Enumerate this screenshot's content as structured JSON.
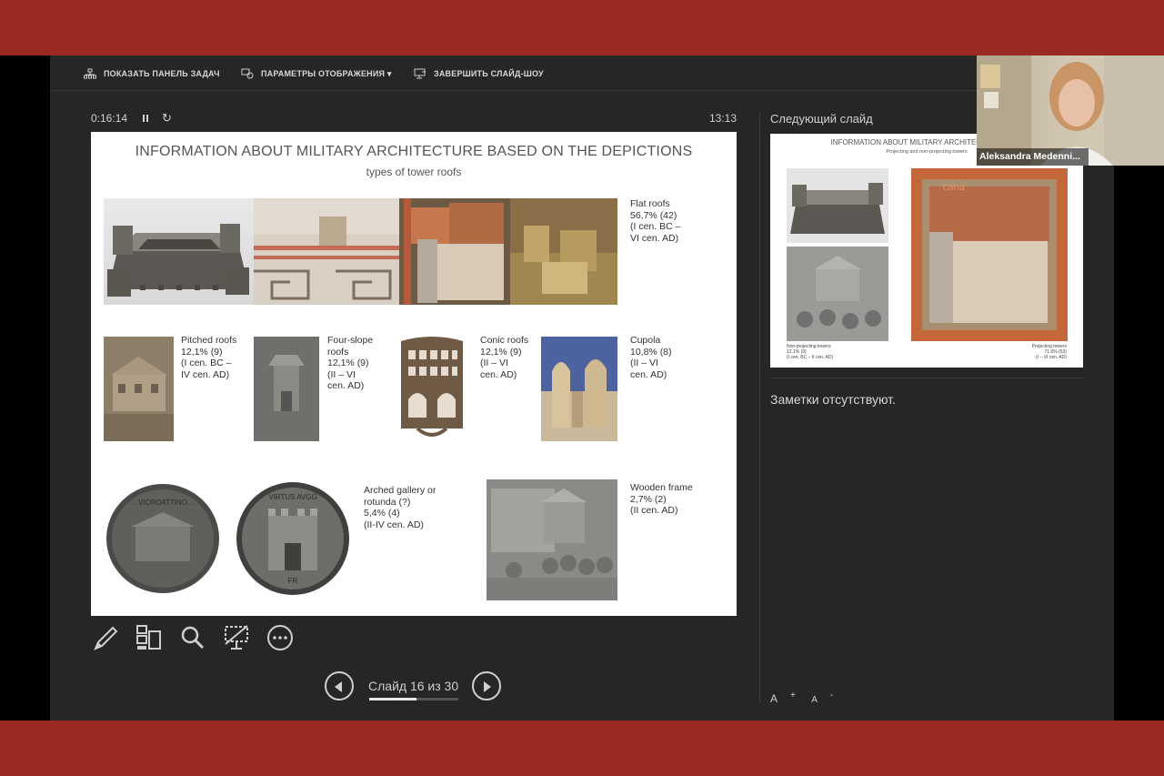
{
  "frame": {
    "band_color": "#9a2a22",
    "panel_color": "#262626"
  },
  "toolbar": {
    "show_taskbar": "ПОКАЗАТЬ ПАНЕЛЬ ЗАДАЧ",
    "display_settings": "ПАРАМЕТРЫ ОТОБРАЖЕНИЯ ▾",
    "end_show": "ЗАВЕРШИТЬ СЛАЙД-ШОУ"
  },
  "timer": {
    "elapsed": "0:16:14",
    "reset_glyph": "↻",
    "clock": "13:13"
  },
  "slide": {
    "title": "INFORMATION ABOUT MILITARY ARCHITECTURE BASED ON THE DEPICTIONS",
    "subtitle": "types of tower roofs",
    "labels": {
      "flat": "Flat roofs\n56,7% (42)\n(I  cen. BC –\nVI cen. AD)",
      "pitched": "Pitched roofs\n12,1% (9)\n(I cen. BC –\nIV cen. AD)",
      "four_slope": "Four-slope\nroofs\n12,1% (9)\n(II – VI\ncen. AD)",
      "conic": "Conic roofs\n12,1% (9)\n(II – VI\ncen. AD)",
      "cupola": "Cupola\n10,8% (8)\n(II – VI\ncen. AD)",
      "arched": "Arched gallery or\nrotunda (?)\n5,4% (4)\n(II-IV cen. AD)",
      "wooden": "Wooden frame\n2,7% (2)\n(II cen. AD)"
    },
    "coin1_legend": "…VICROATTINO…",
    "coin2_legend": "VIRTUS AVGG",
    "coin2_mint": "FR"
  },
  "controls": {
    "pen": "pen-tool-icon",
    "see_all": "see-all-slides-icon",
    "zoom": "zoom-icon",
    "screen": "black-screen-icon",
    "more": "more-options-icon"
  },
  "navigation": {
    "label": "Слайд 16 из 30",
    "current": 16,
    "total": 30
  },
  "next_slide": {
    "heading": "Следующий слайд",
    "title": "INFORMATION ABOUT MILITARY ARCHITECTURE BASE",
    "subtitle": "Projecting and non-projecting towers",
    "watermark": "cana",
    "caption_left": "Non-projecting towers\n12,1% (9)\n(I cen. BC – II cen. AD)",
    "caption_right": "Projecting towers\n71,6% (53)\n(I – VI cen. AD)"
  },
  "notes": "Заметки отсутствуют.",
  "font_buttons": {
    "increase": "A",
    "decrease": "A"
  },
  "webcam": {
    "name": "Aleksandra Medenni..."
  }
}
